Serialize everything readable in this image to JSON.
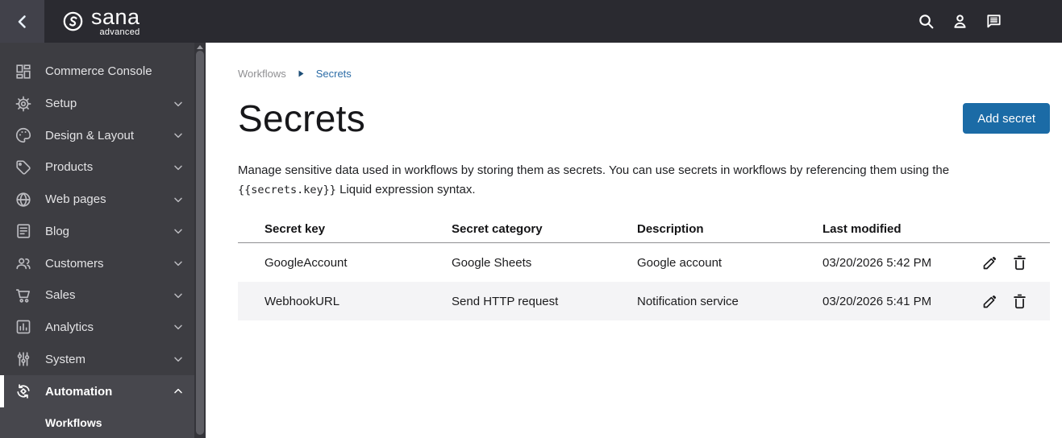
{
  "topbar": {
    "logo": {
      "name": "sana",
      "tagline": "advanced"
    }
  },
  "sidebar": {
    "items": [
      {
        "label": "Commerce Console"
      },
      {
        "label": "Setup"
      },
      {
        "label": "Design & Layout"
      },
      {
        "label": "Products"
      },
      {
        "label": "Web pages"
      },
      {
        "label": "Blog"
      },
      {
        "label": "Customers"
      },
      {
        "label": "Sales"
      },
      {
        "label": "Analytics"
      },
      {
        "label": "System"
      },
      {
        "label": "Automation"
      }
    ],
    "subitems": [
      {
        "label": "Workflows"
      }
    ]
  },
  "breadcrumb": {
    "items": [
      "Workflows",
      "Secrets"
    ]
  },
  "page": {
    "title": "Secrets",
    "add_button_label": "Add secret",
    "description_before_code": "Manage sensitive data used in workflows by storing them as secrets. You can use secrets in workflows by referencing them using the ",
    "description_code": "{{secrets.key}}",
    "description_after_code": " Liquid expression syntax."
  },
  "table": {
    "columns": [
      "Secret key",
      "Secret category",
      "Description",
      "Last modified"
    ],
    "rows": [
      {
        "secret_key": "GoogleAccount",
        "secret_category": "Google Sheets",
        "description": "Google account",
        "last_modified": "03/20/2026 5:42 PM"
      },
      {
        "secret_key": "WebhookURL",
        "secret_category": "Send HTTP request",
        "description": "Notification service",
        "last_modified": "03/20/2026 5:41 PM"
      }
    ]
  },
  "colors": {
    "accent_blue": "#1b6ba6",
    "topbar_bg": "#2a2a30",
    "sidebar_bg": "#3d3d42",
    "sidebar_active_bg": "#47474d",
    "row_stripe": "#f4f4f6",
    "breadcrumb_link_blue": "#2d6da7"
  }
}
